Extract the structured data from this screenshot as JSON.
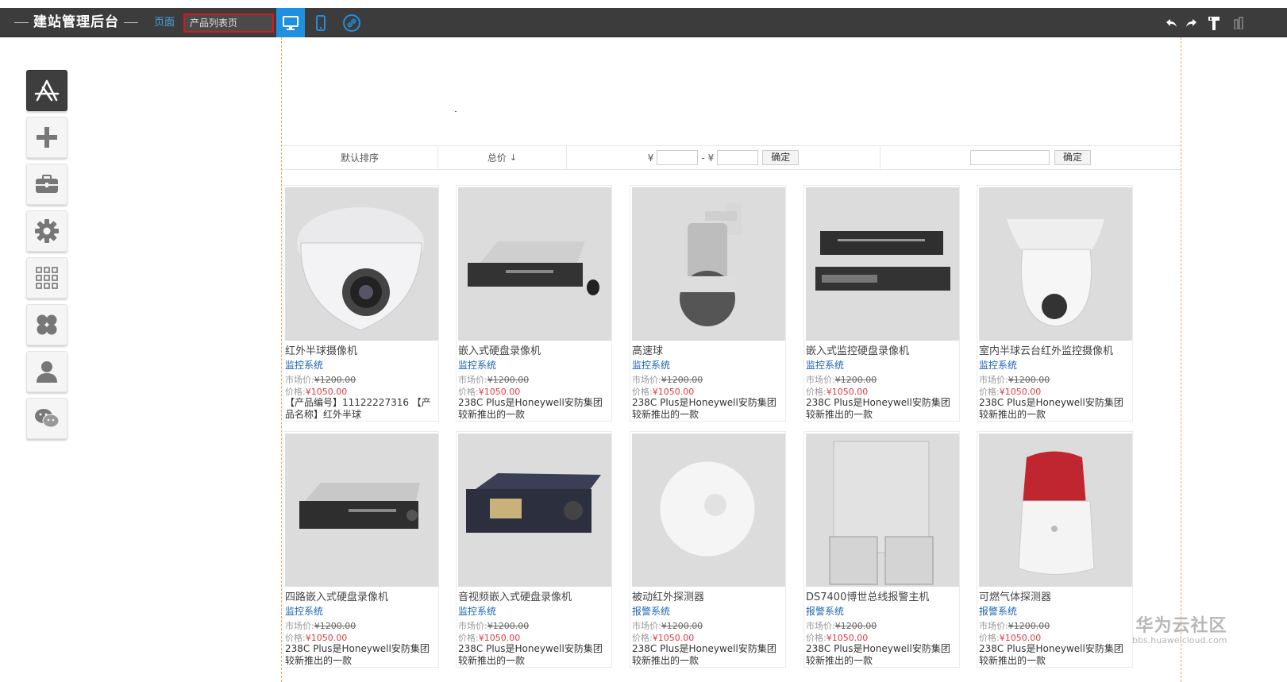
{
  "toolbar": {
    "title": "建站管理后台",
    "page_label": "页面",
    "page_select_value": "产品列表页"
  },
  "sidebar": {
    "items": [
      "app-icon",
      "add-icon",
      "toolbox-icon",
      "gear-icon",
      "grid-icon",
      "clover-icon",
      "user-icon",
      "wechat-icon"
    ]
  },
  "filter": {
    "default_sort": "默认排序",
    "total_price": "总价",
    "sort_arrow": "↓",
    "currency": "¥",
    "range_sep": "- ¥",
    "confirm": "确定",
    "confirm2": "确定"
  },
  "products": [
    {
      "name": "红外半球摄像机",
      "category": "监控系统",
      "market_label": "市场价:",
      "market_price": "¥1200.00",
      "price_label": "价格:",
      "price": "¥1050.00",
      "desc": "【产品编号】11122227316 【产品名称】红外半球"
    },
    {
      "name": "嵌入式硬盘录像机",
      "category": "监控系统",
      "market_label": "市场价:",
      "market_price": "¥1200.00",
      "price_label": "价格:",
      "price": "¥1050.00",
      "desc": "238C Plus是Honeywell安防集团较新推出的一款"
    },
    {
      "name": "高速球",
      "category": "监控系统",
      "market_label": "市场价:",
      "market_price": "¥1200.00",
      "price_label": "价格:",
      "price": "¥1050.00",
      "desc": "238C Plus是Honeywell安防集团较新推出的一款"
    },
    {
      "name": "嵌入式监控硬盘录像机",
      "category": "监控系统",
      "market_label": "市场价:",
      "market_price": "¥1200.00",
      "price_label": "价格:",
      "price": "¥1050.00",
      "desc": "238C Plus是Honeywell安防集团较新推出的一款"
    },
    {
      "name": "室内半球云台红外监控摄像机",
      "category": "监控系统",
      "market_label": "市场价:",
      "market_price": "¥1200.00",
      "price_label": "价格:",
      "price": "¥1050.00",
      "desc": "238C Plus是Honeywell安防集团较新推出的一款"
    },
    {
      "name": "四路嵌入式硬盘录像机",
      "category": "监控系统",
      "market_label": "市场价:",
      "market_price": "¥1200.00",
      "price_label": "价格:",
      "price": "¥1050.00",
      "desc": "238C Plus是Honeywell安防集团较新推出的一款"
    },
    {
      "name": "音视频嵌入式硬盘录像机",
      "category": "监控系统",
      "market_label": "市场价:",
      "market_price": "¥1200.00",
      "price_label": "价格:",
      "price": "¥1050.00",
      "desc": "238C Plus是Honeywell安防集团较新推出的一款"
    },
    {
      "name": "被动红外探测器",
      "category": "报警系统",
      "market_label": "市场价:",
      "market_price": "¥1200.00",
      "price_label": "价格:",
      "price": "¥1050.00",
      "desc": "238C Plus是Honeywell安防集团较新推出的一款"
    },
    {
      "name": "DS7400博世总线报警主机",
      "category": "报警系统",
      "market_label": "市场价:",
      "market_price": "¥1200.00",
      "price_label": "价格:",
      "price": "¥1050.00",
      "desc": "238C Plus是Honeywell安防集团较新推出的一款"
    },
    {
      "name": "可燃气体探测器",
      "category": "报警系统",
      "market_label": "市场价:",
      "market_price": "¥1200.00",
      "price_label": "价格:",
      "price": "¥1050.00",
      "desc": "238C Plus是Honeywell安防集团较新推出的一款"
    }
  ],
  "watermark": {
    "cn": "华为云社区",
    "en": "bbs.huaweicloud.com"
  }
}
